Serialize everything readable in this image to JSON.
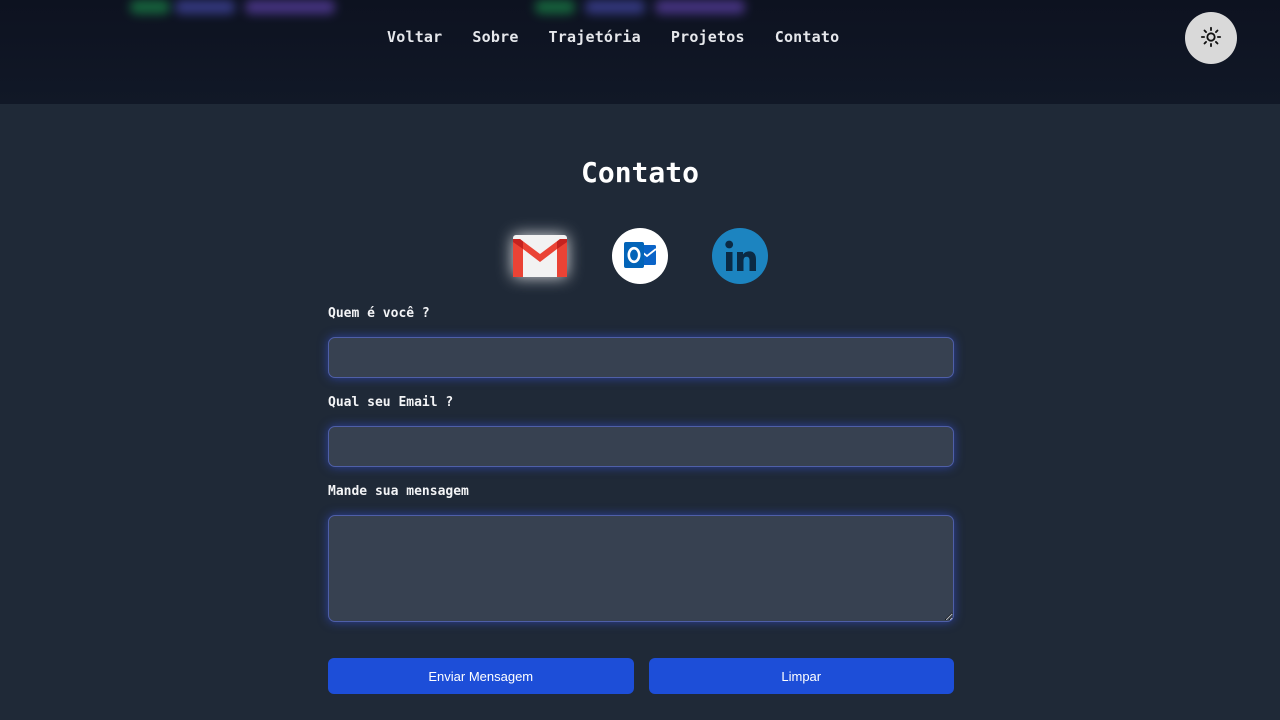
{
  "nav": {
    "items": [
      {
        "label": "Voltar"
      },
      {
        "label": "Sobre"
      },
      {
        "label": "Trajetória"
      },
      {
        "label": "Projetos"
      },
      {
        "label": "Contato"
      }
    ],
    "theme_toggle_icon": "sun-icon"
  },
  "page": {
    "title": "Contato"
  },
  "social": [
    {
      "name": "Gmail",
      "icon": "gmail-icon",
      "color": "#ea4335"
    },
    {
      "name": "Outlook",
      "icon": "outlook-icon",
      "color": "#0a64c8"
    },
    {
      "name": "LinkedIn",
      "icon": "linkedin-icon",
      "color": "#1c84c0"
    }
  ],
  "form": {
    "name_label": "Quem é você ?",
    "name_value": "",
    "email_label": "Qual seu Email ?",
    "email_value": "",
    "message_label": "Mande sua mensagem",
    "message_value": ""
  },
  "actions": {
    "send_label": "Enviar Mensagem",
    "clear_label": "Limpar"
  },
  "colors": {
    "background": "#1f2937",
    "header": "#111827",
    "field": "#374151",
    "button": "#1d4ed8"
  }
}
